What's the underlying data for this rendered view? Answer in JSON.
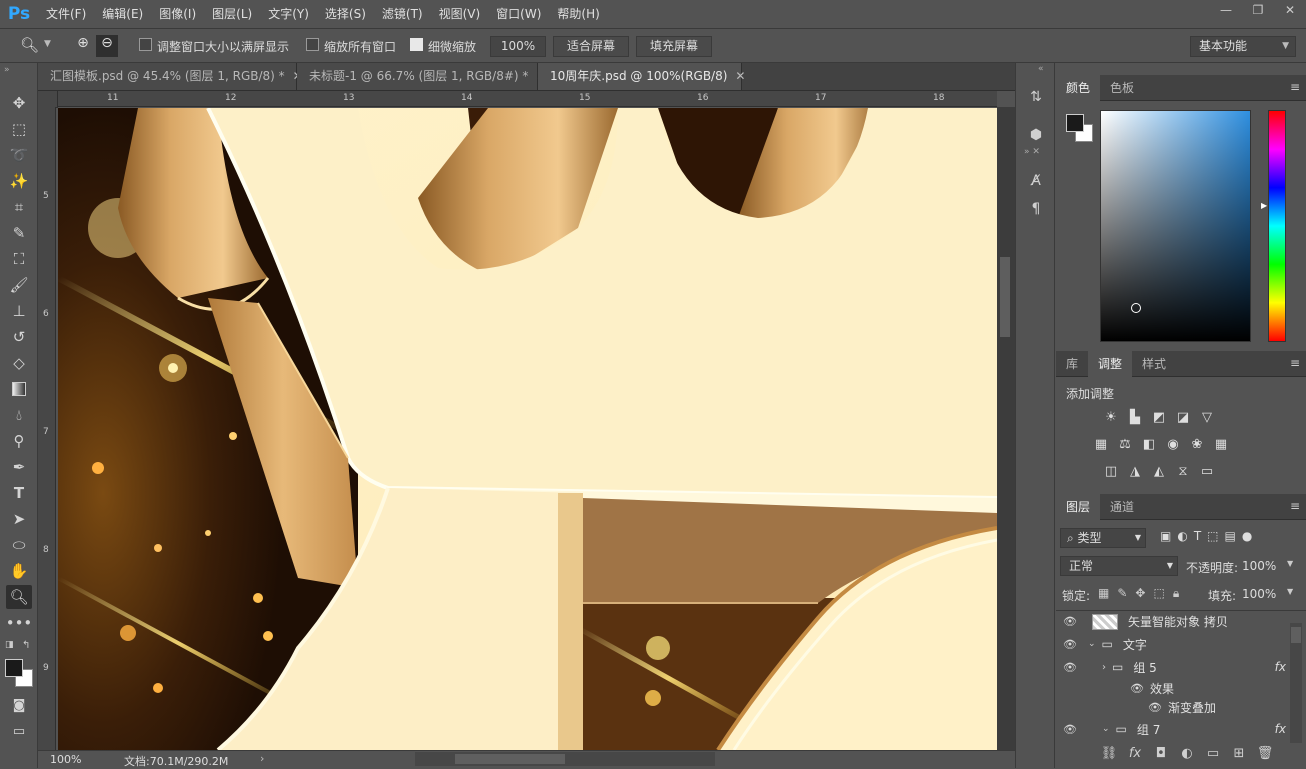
{
  "app": {
    "logo": "Ps"
  },
  "menu": [
    "文件(F)",
    "编辑(E)",
    "图像(I)",
    "图层(L)",
    "文字(Y)",
    "选择(S)",
    "滤镜(T)",
    "视图(V)",
    "窗口(W)",
    "帮助(H)"
  ],
  "window_buttons": [
    "—",
    "❐",
    "✕"
  ],
  "options": {
    "resize_windows_label": "调整窗口大小以满屏显示",
    "zoom_all_label": "缩放所有窗口",
    "scrubby_zoom_label": "细微缩放",
    "zoom_value": "100%",
    "fit_screen_label": "适合屏幕",
    "fill_screen_label": "填充屏幕",
    "workspace": "基本功能"
  },
  "tabs": [
    {
      "label": "汇图模板.psd @ 45.4% (图层 1, RGB/8) *"
    },
    {
      "label": "未标题-1 @ 66.7% (图层 1, RGB/8#) *"
    },
    {
      "label": "10周年庆.psd @ 100%(RGB/8)"
    }
  ],
  "tab_close": "✕",
  "ruler": {
    "top": [
      "11",
      "12",
      "13",
      "14",
      "15",
      "16",
      "17",
      "18"
    ],
    "left": [
      "5",
      "6",
      "7",
      "8",
      "9"
    ]
  },
  "status": {
    "zoom": "100%",
    "doc": "文档:70.1M/290.2M"
  },
  "color_panel": {
    "tabs": [
      "颜色",
      "色板"
    ],
    "fg": "#1a1a1a",
    "bg": "#ffffff"
  },
  "adjust_panel": {
    "tabs": [
      "库",
      "调整",
      "样式"
    ],
    "title": "添加调整"
  },
  "layers_panel": {
    "tabs": [
      "图层",
      "通道"
    ],
    "filter": "类型",
    "blend_mode": "正常",
    "opacity_label": "不透明度:",
    "opacity": "100%",
    "lock_label": "锁定:",
    "fill_label": "填充:",
    "fill": "100%",
    "layers": [
      {
        "name": "矢量智能对象 拷贝"
      },
      {
        "name": "文字"
      },
      {
        "name": "组 5"
      },
      {
        "name": "效果"
      },
      {
        "name": "渐变叠加"
      },
      {
        "name": "组 7"
      }
    ],
    "fx": "fx"
  }
}
